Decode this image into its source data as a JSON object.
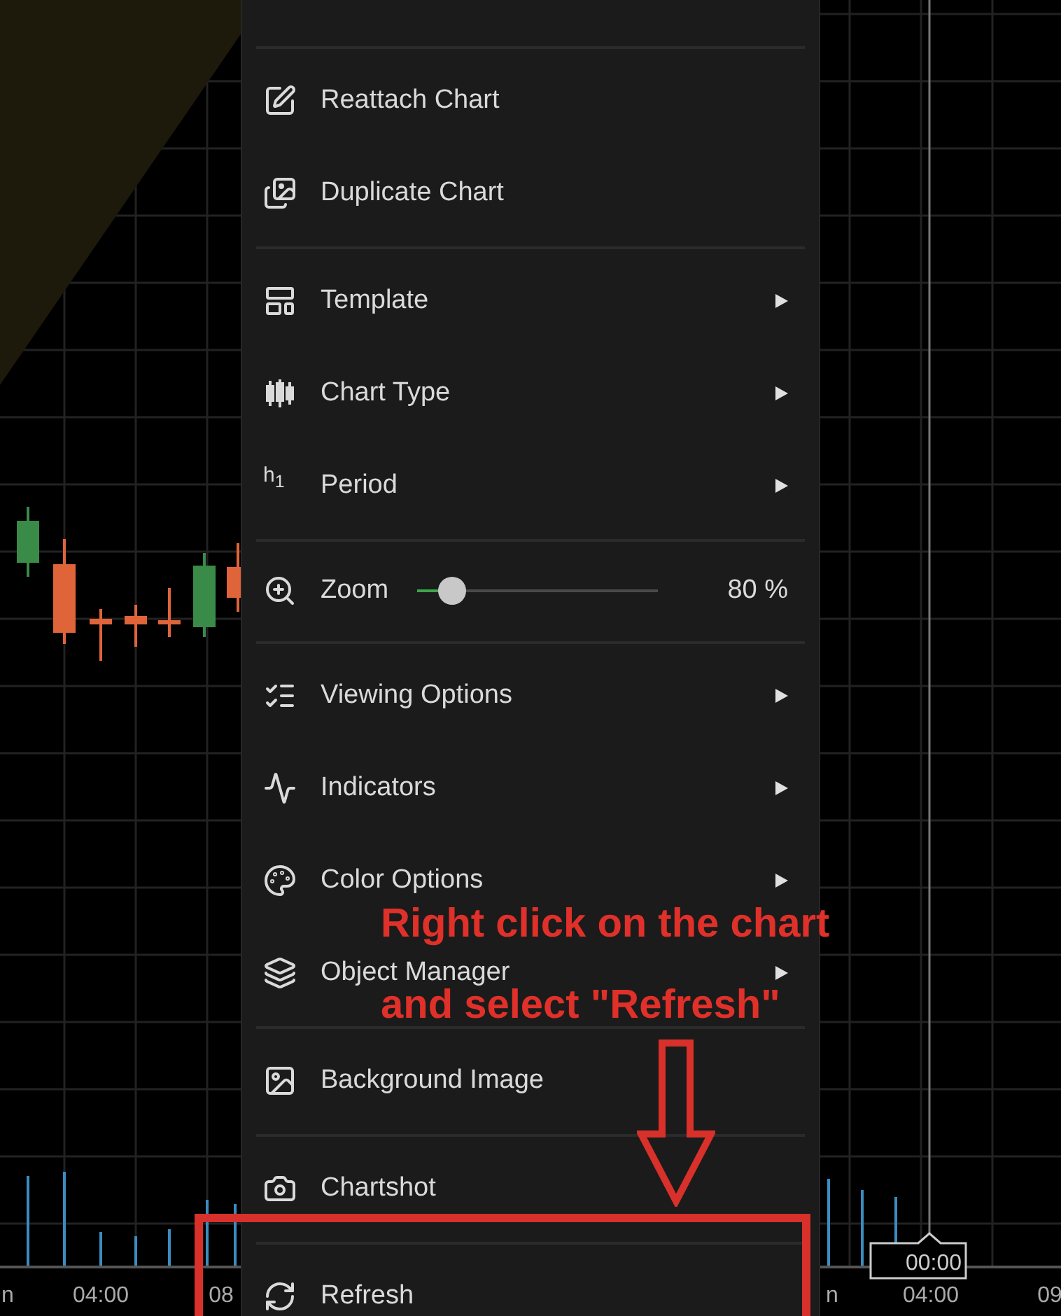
{
  "chart": {
    "kind": "candlestick",
    "time_labels": [
      "n",
      "04:00",
      "08",
      "n",
      "04:00",
      "09"
    ],
    "crosshair_label": "00:00"
  },
  "context_menu": {
    "items": [
      {
        "kind": "separator"
      },
      {
        "kind": "item",
        "label": "Reattach Chart",
        "submenu": false
      },
      {
        "kind": "item",
        "label": "Duplicate Chart",
        "submenu": false
      },
      {
        "kind": "separator"
      },
      {
        "kind": "item",
        "label": "Template",
        "submenu": true
      },
      {
        "kind": "item",
        "label": "Chart Type",
        "submenu": true
      },
      {
        "kind": "item",
        "label": "Period",
        "submenu": true,
        "glyph": "h$_{1}$"
      },
      {
        "kind": "separator"
      },
      {
        "kind": "slider",
        "label": "Zoom",
        "level": 0.15,
        "reading": "80 %"
      },
      {
        "kind": "separator"
      },
      {
        "kind": "item",
        "label": "Viewing Options",
        "submenu": true
      },
      {
        "kind": "item",
        "label": "Indicators",
        "submenu": true
      },
      {
        "kind": "item",
        "label": "Color Options",
        "submenu": true
      },
      {
        "kind": "item",
        "label": "Object Manager",
        "submenu": true
      },
      {
        "kind": "separator"
      },
      {
        "kind": "item",
        "label": "Background Image",
        "submenu": false
      },
      {
        "kind": "separator"
      },
      {
        "kind": "item",
        "label": "Chartshot",
        "submenu": false
      },
      {
        "kind": "separator"
      },
      {
        "kind": "item",
        "label": "Refresh",
        "submenu": false
      }
    ]
  },
  "annotation": {
    "lines": [
      "Right click on the chart",
      "and select \"Refresh\""
    ]
  }
}
